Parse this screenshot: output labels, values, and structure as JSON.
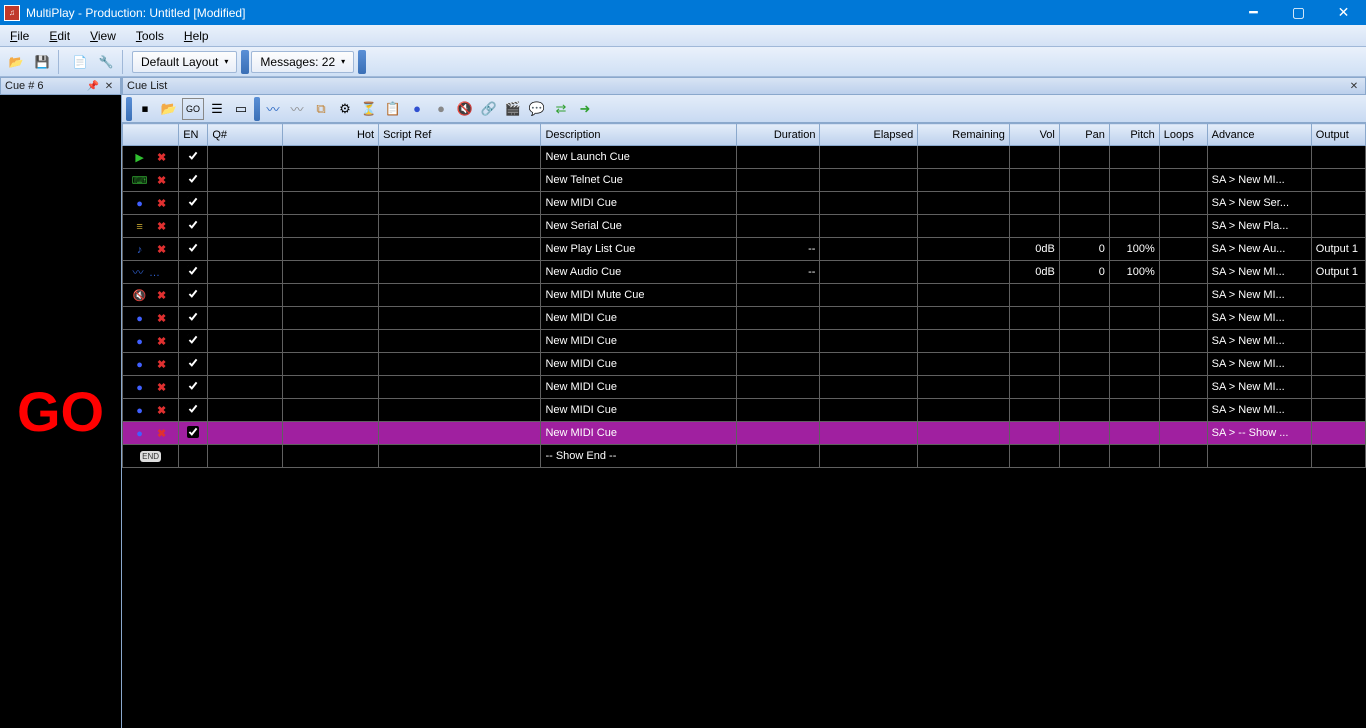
{
  "titlebar": {
    "title": "MultiPlay - Production: Untitled [Modified]"
  },
  "menu": {
    "file": "File",
    "edit": "Edit",
    "view": "View",
    "tools": "Tools",
    "help": "Help"
  },
  "toolbar": {
    "layout_dd": "Default Layout",
    "messages_dd": "Messages: 22"
  },
  "left": {
    "header": "Cue # 6",
    "go": "GO"
  },
  "cuelist": {
    "header": "Cue List",
    "columns": {
      "icon": "",
      "en": "EN",
      "q": "Q#",
      "hot": "Hot",
      "script": "Script Ref",
      "desc": "Description",
      "dur": "Duration",
      "elap": "Elapsed",
      "rem": "Remaining",
      "vol": "Vol",
      "pan": "Pan",
      "pitch": "Pitch",
      "loops": "Loops",
      "adv": "Advance",
      "out": "Output"
    },
    "rows": [
      {
        "icon": "launch",
        "en": true,
        "desc": "New Launch Cue",
        "dur": "",
        "vol": "",
        "pan": "",
        "pitch": "",
        "adv": "",
        "out": ""
      },
      {
        "icon": "telnet",
        "en": true,
        "desc": "New Telnet Cue",
        "dur": "",
        "vol": "",
        "pan": "",
        "pitch": "",
        "adv": "SA > New MI...",
        "out": ""
      },
      {
        "icon": "midi",
        "en": true,
        "desc": "New MIDI Cue",
        "dur": "",
        "vol": "",
        "pan": "",
        "pitch": "",
        "adv": "SA > New Ser...",
        "out": ""
      },
      {
        "icon": "serial",
        "en": true,
        "desc": "New Serial Cue",
        "dur": "",
        "vol": "",
        "pan": "",
        "pitch": "",
        "adv": "SA > New Pla...",
        "out": ""
      },
      {
        "icon": "playlist",
        "en": true,
        "desc": "New Play List Cue",
        "dur": "--",
        "vol": "0dB",
        "pan": "0",
        "pitch": "100%",
        "adv": "SA > New Au...",
        "out": "Output 1"
      },
      {
        "icon": "audio",
        "en": true,
        "desc": "New Audio Cue",
        "dur": "--",
        "vol": "0dB",
        "pan": "0",
        "pitch": "100%",
        "adv": "SA > New MI...",
        "out": "Output 1"
      },
      {
        "icon": "midimute",
        "en": true,
        "desc": "New MIDI Mute Cue",
        "dur": "",
        "vol": "",
        "pan": "",
        "pitch": "",
        "adv": "SA > New MI...",
        "out": ""
      },
      {
        "icon": "midi",
        "en": true,
        "desc": "New MIDI Cue",
        "dur": "",
        "vol": "",
        "pan": "",
        "pitch": "",
        "adv": "SA > New MI...",
        "out": ""
      },
      {
        "icon": "midi",
        "en": true,
        "desc": "New MIDI Cue",
        "dur": "",
        "vol": "",
        "pan": "",
        "pitch": "",
        "adv": "SA > New MI...",
        "out": ""
      },
      {
        "icon": "midi",
        "en": true,
        "desc": "New MIDI Cue",
        "dur": "",
        "vol": "",
        "pan": "",
        "pitch": "",
        "adv": "SA > New MI...",
        "out": ""
      },
      {
        "icon": "midi",
        "en": true,
        "desc": "New MIDI Cue",
        "dur": "",
        "vol": "",
        "pan": "",
        "pitch": "",
        "adv": "SA > New MI...",
        "out": ""
      },
      {
        "icon": "midi",
        "en": true,
        "desc": "New MIDI Cue",
        "dur": "",
        "vol": "",
        "pan": "",
        "pitch": "",
        "adv": "SA > New MI...",
        "out": ""
      },
      {
        "icon": "midi",
        "en": true,
        "desc": "New MIDI Cue",
        "dur": "",
        "vol": "",
        "pan": "",
        "pitch": "",
        "adv": "SA > -- Show ...",
        "out": "",
        "selected": true
      },
      {
        "icon": "end",
        "en": false,
        "desc": "-- Show End --",
        "dur": "",
        "vol": "",
        "pan": "",
        "pitch": "",
        "adv": "",
        "out": "",
        "noCheck": true
      }
    ]
  }
}
